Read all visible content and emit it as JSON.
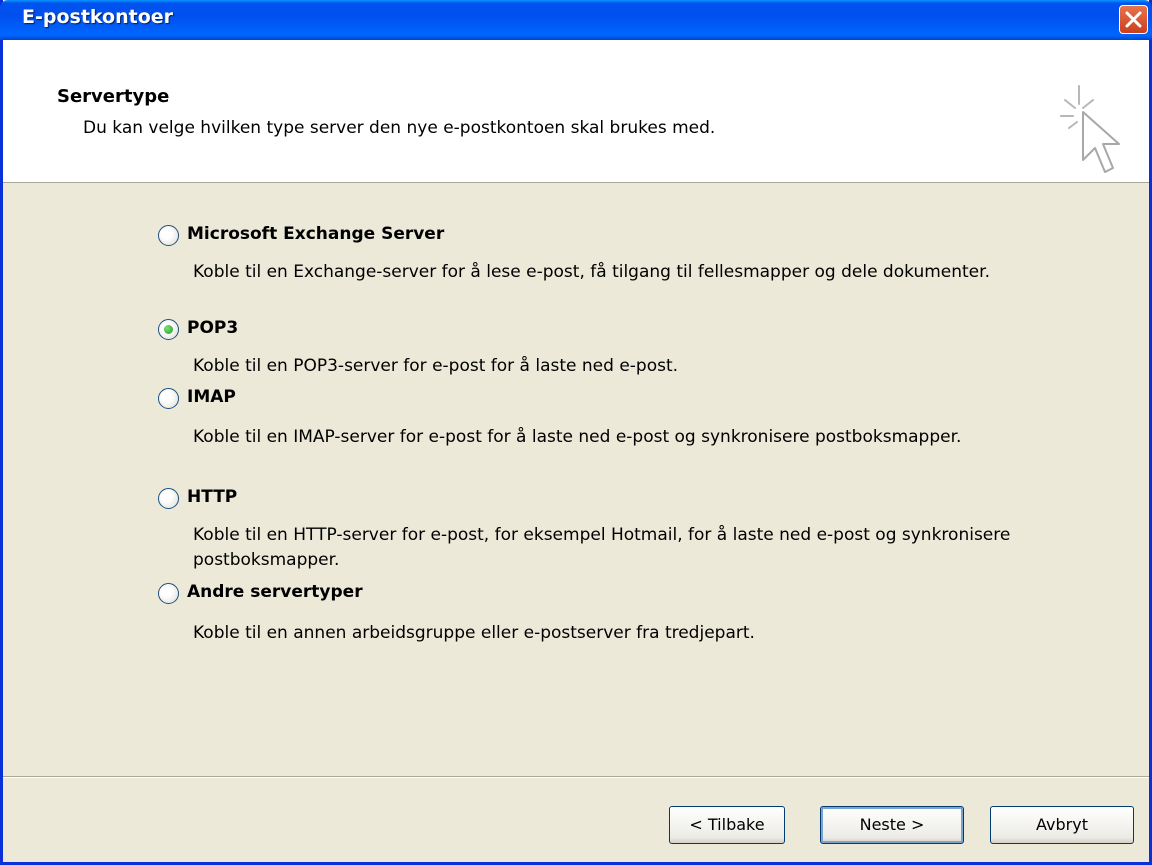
{
  "window": {
    "title": "E-postkontoer"
  },
  "header": {
    "title": "Servertype",
    "subtitle": "Du kan velge hvilken type server den nye e-postkontoen skal brukes med."
  },
  "options": [
    {
      "label": "Microsoft Exchange Server",
      "description": "Koble til en Exchange-server for å lese e-post, få tilgang til fellesmapper og dele dokumenter.",
      "selected": false
    },
    {
      "label": "POP3",
      "description": "Koble til en POP3-server for e-post for å laste ned e-post.",
      "selected": true
    },
    {
      "label": "IMAP",
      "description": "Koble til en IMAP-server for e-post for å laste ned e-post og synkronisere postboksmapper.",
      "selected": false
    },
    {
      "label": "HTTP",
      "description": "Koble til en HTTP-server for e-post, for eksempel Hotmail, for å laste ned e-post og synkronisere postboksmapper.",
      "selected": false
    },
    {
      "label": "Andre servertyper",
      "description": "Koble til en annen arbeidsgruppe eller e-postserver fra tredjepart.",
      "selected": false
    }
  ],
  "buttons": {
    "back": "< Tilbake",
    "next": "Neste >",
    "cancel": "Avbryt"
  },
  "icons": {
    "close": "close-icon",
    "wizard": "cursor-sparkle-icon",
    "radio_selected_color": "#21a121"
  }
}
